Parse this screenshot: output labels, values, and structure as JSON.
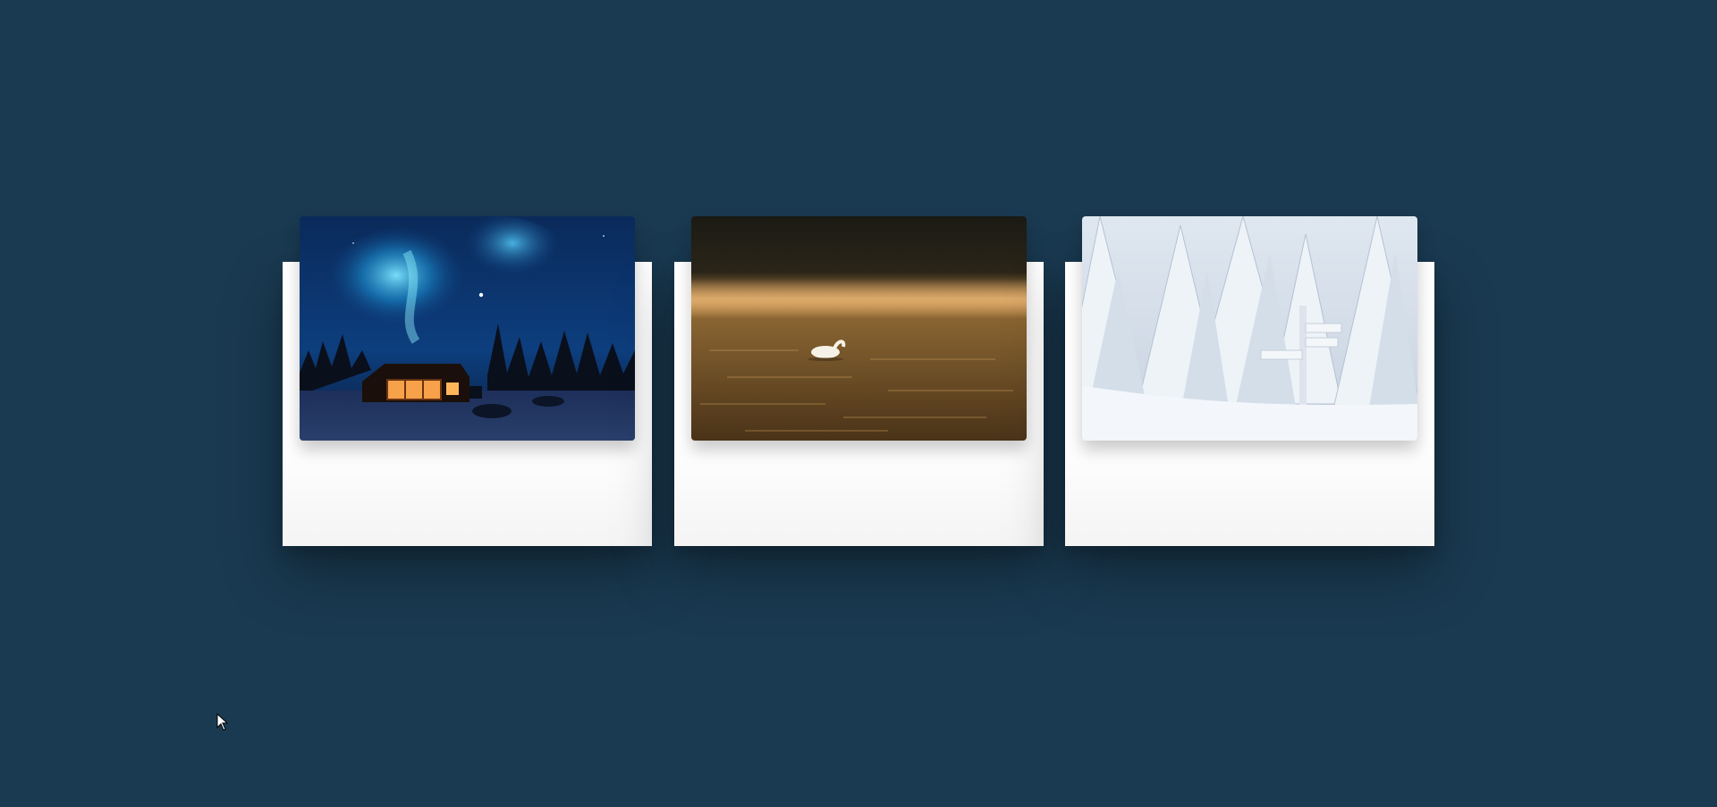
{
  "page": {
    "background_color": "#1a3a51"
  },
  "cards": [
    {
      "scene": "aurora-cabin-night",
      "accent": "#1b8fd0"
    },
    {
      "scene": "swan-on-misty-lake",
      "accent": "#c08a4a"
    },
    {
      "scene": "snowy-forest-signpost",
      "accent": "#e9eef4"
    }
  ],
  "cursor": {
    "icon": "arrow-cursor-icon"
  }
}
